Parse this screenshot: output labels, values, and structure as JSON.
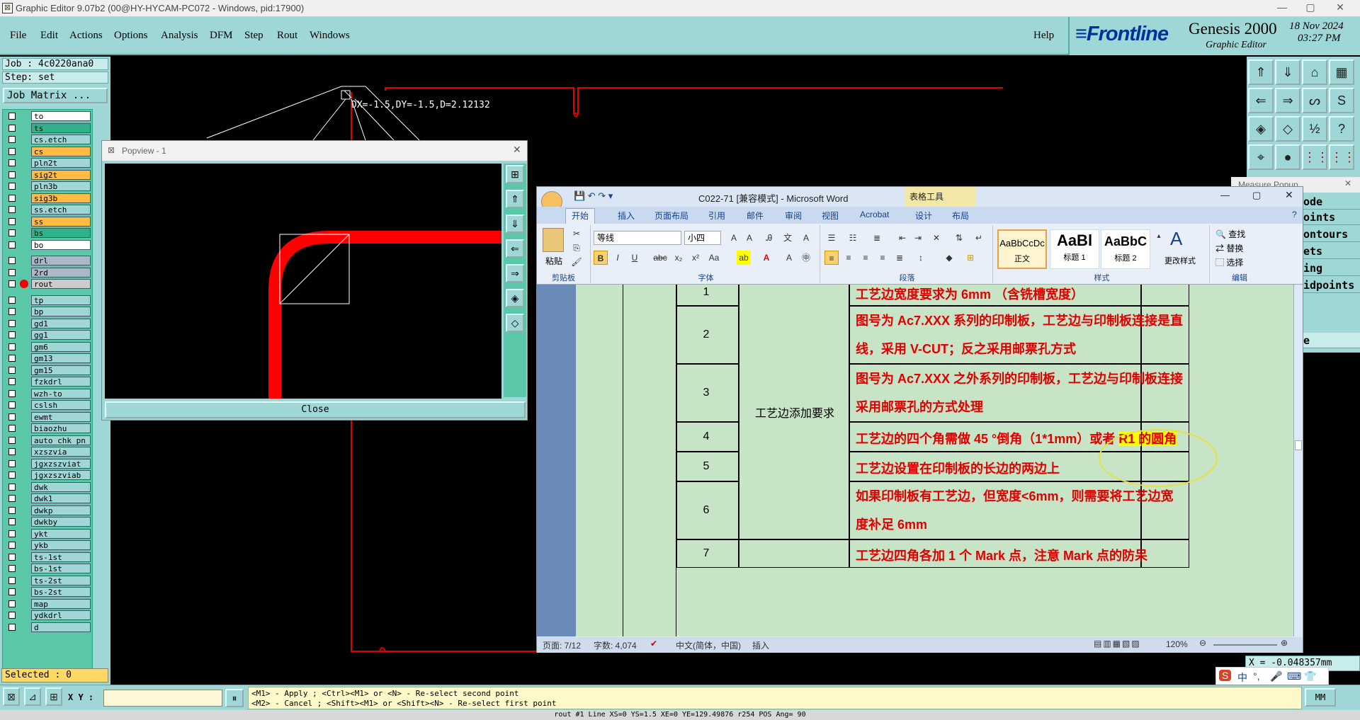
{
  "app": {
    "window_title": "Graphic Editor 9.07b2 (00@HY-HYCAM-PC072 - Windows, pid:17900)",
    "menu": [
      "File",
      "Edit",
      "Actions",
      "Options",
      "Analysis",
      "DFM",
      "Step",
      "Rout",
      "Windows"
    ],
    "help": "Help",
    "brand_logo": "Frontline",
    "brand_product": "Genesis 2000",
    "brand_sub": "Graphic Editor",
    "date": "18 Nov 2024",
    "time": "03:27 PM"
  },
  "left_panel": {
    "job": "Job : 4c0220ana0",
    "step": "Step: set",
    "job_matrix": "Job Matrix ...",
    "selected": "Selected : 0",
    "layers": [
      {
        "name": "to",
        "color": "#ffffff"
      },
      {
        "name": "ts",
        "color": "#2fb28a"
      },
      {
        "name": "cs.etch",
        "color": "#9fd6d6"
      },
      {
        "name": "cs",
        "color": "#ffbb44"
      },
      {
        "name": "pln2t",
        "color": "#9fd6d6"
      },
      {
        "name": "sig2t",
        "color": "#ffbb44"
      },
      {
        "name": "pln3b",
        "color": "#9fd6d6"
      },
      {
        "name": "sig3b",
        "color": "#ffbb44"
      },
      {
        "name": "ss.etch",
        "color": "#9fd6d6"
      },
      {
        "name": "ss",
        "color": "#ffbb44"
      },
      {
        "name": "bs",
        "color": "#2fb28a"
      },
      {
        "name": "bo",
        "color": "#ffffff"
      },
      {
        "name": "drl",
        "color": "#aab8c8"
      },
      {
        "name": "2rd",
        "color": "#aab8c8"
      },
      {
        "name": "rout",
        "color": "#cccccc"
      },
      {
        "name": "tp",
        "color": "#9fd6d6"
      },
      {
        "name": "bp",
        "color": "#9fd6d6"
      },
      {
        "name": "gd1",
        "color": "#9fd6d6"
      },
      {
        "name": "gg1",
        "color": "#9fd6d6"
      },
      {
        "name": "gm6",
        "color": "#9fd6d6"
      },
      {
        "name": "gm13",
        "color": "#9fd6d6"
      },
      {
        "name": "gm15",
        "color": "#9fd6d6"
      },
      {
        "name": "fzkdrl",
        "color": "#9fd6d6"
      },
      {
        "name": "wzh-to",
        "color": "#9fd6d6"
      },
      {
        "name": "cslsh",
        "color": "#9fd6d6"
      },
      {
        "name": "ewmt",
        "color": "#9fd6d6"
      },
      {
        "name": "biaozhu",
        "color": "#9fd6d6"
      },
      {
        "name": "auto_chk_pn",
        "color": "#9fd6d6"
      },
      {
        "name": "xzszvia",
        "color": "#9fd6d6"
      },
      {
        "name": "jgxzszviat",
        "color": "#9fd6d6"
      },
      {
        "name": "jgxzszviab",
        "color": "#9fd6d6"
      },
      {
        "name": "dwk",
        "color": "#9fd6d6"
      },
      {
        "name": "dwk1",
        "color": "#9fd6d6"
      },
      {
        "name": "dwkp",
        "color": "#9fd6d6"
      },
      {
        "name": "dwkby",
        "color": "#9fd6d6"
      },
      {
        "name": "ykt",
        "color": "#9fd6d6"
      },
      {
        "name": "ykb",
        "color": "#9fd6d6"
      },
      {
        "name": "ts-1st",
        "color": "#9fd6d6"
      },
      {
        "name": "bs-1st",
        "color": "#9fd6d6"
      },
      {
        "name": "ts-2st",
        "color": "#9fd6d6"
      },
      {
        "name": "bs-2st",
        "color": "#9fd6d6"
      },
      {
        "name": "map",
        "color": "#9fd6d6"
      },
      {
        "name": "ydkdrl",
        "color": "#9fd6d6"
      },
      {
        "name": "d",
        "color": "#9fd6d6"
      }
    ]
  },
  "canvas": {
    "measure_text": "DX=-1.5,DY=-1.5,D=2.12132"
  },
  "popview": {
    "title": "Popview - 1",
    "close": "Close"
  },
  "measure_popup": {
    "title": "Measure Popup",
    "items": [
      "Mode",
      "oints",
      "ontours",
      "ets",
      "ing",
      "idpoints",
      "e"
    ],
    "coord": "X = -0.048357mm"
  },
  "bottom": {
    "xy_label": "X Y :",
    "xy_value": "",
    "msg1": "<M1> - Apply  ; <Ctrl><M1> or <N> - Re-select second point",
    "msg2": "<M2> - Cancel ; <Shift><M1> or <Shift><N> - Re-select first point",
    "status": "rout #1 Line XS=0 YS=1.5 XE=0 YE=129.49876 r254 POS Ang= 90",
    "unit": "MM"
  },
  "word": {
    "title": "C022-71 [兼容模式] - Microsoft Word",
    "context_tab": "表格工具",
    "tabs": [
      "开始",
      "插入",
      "页面布局",
      "引用",
      "邮件",
      "审阅",
      "视图",
      "Acrobat",
      "设计",
      "布局"
    ],
    "font_name": "等线",
    "font_size": "小四",
    "group_labels": [
      "剪贴板",
      "字体",
      "段落",
      "样式",
      "编辑"
    ],
    "paste": "粘贴",
    "styles": [
      {
        "preview": "AaBbCcDc",
        "name": "正文"
      },
      {
        "preview": "AaBl",
        "name": "标题 1"
      },
      {
        "preview": "AaBbC",
        "name": "标题 2"
      }
    ],
    "change_styles": "更改样式",
    "edit_items": [
      "查找",
      "替换",
      "选择"
    ],
    "merged_cell": "工艺边添加要求",
    "rows": [
      {
        "num": "1",
        "lines": [
          "工艺边宽度要求为 6mm （含铣槽宽度）"
        ]
      },
      {
        "num": "2",
        "lines": [
          "图号为 Ac7.XXX 系列的印制板，工艺边与印制板连接是直",
          "线，采用 V-CUT；反之采用邮票孔方式"
        ]
      },
      {
        "num": "3",
        "lines": [
          "图号为 Ac7.XXX 之外系列的印制板，工艺边与印制板连接",
          "采用邮票孔的方式处理"
        ]
      },
      {
        "num": "4",
        "lines": [
          "工艺边的四个角需做 45 °倒角（1*1mm）或者 R1 的圆角"
        ]
      },
      {
        "num": "5",
        "lines": [
          "工艺边设置在印制板的长边的两边上"
        ]
      },
      {
        "num": "6",
        "lines": [
          "如果印制板有工艺边，但宽度<6mm，则需要将工艺边宽",
          "度补足 6mm"
        ]
      },
      {
        "num": "7",
        "lines": [
          "工艺边四角各加 1 个 Mark 点，注意 Mark 点的防呆"
        ]
      }
    ],
    "status": {
      "page": "页面: 7/12",
      "words": "字数: 4,074",
      "lang": "中文(简体，中国)",
      "mode": "插入",
      "zoom": "120%"
    }
  },
  "ime": {
    "label": "中"
  }
}
